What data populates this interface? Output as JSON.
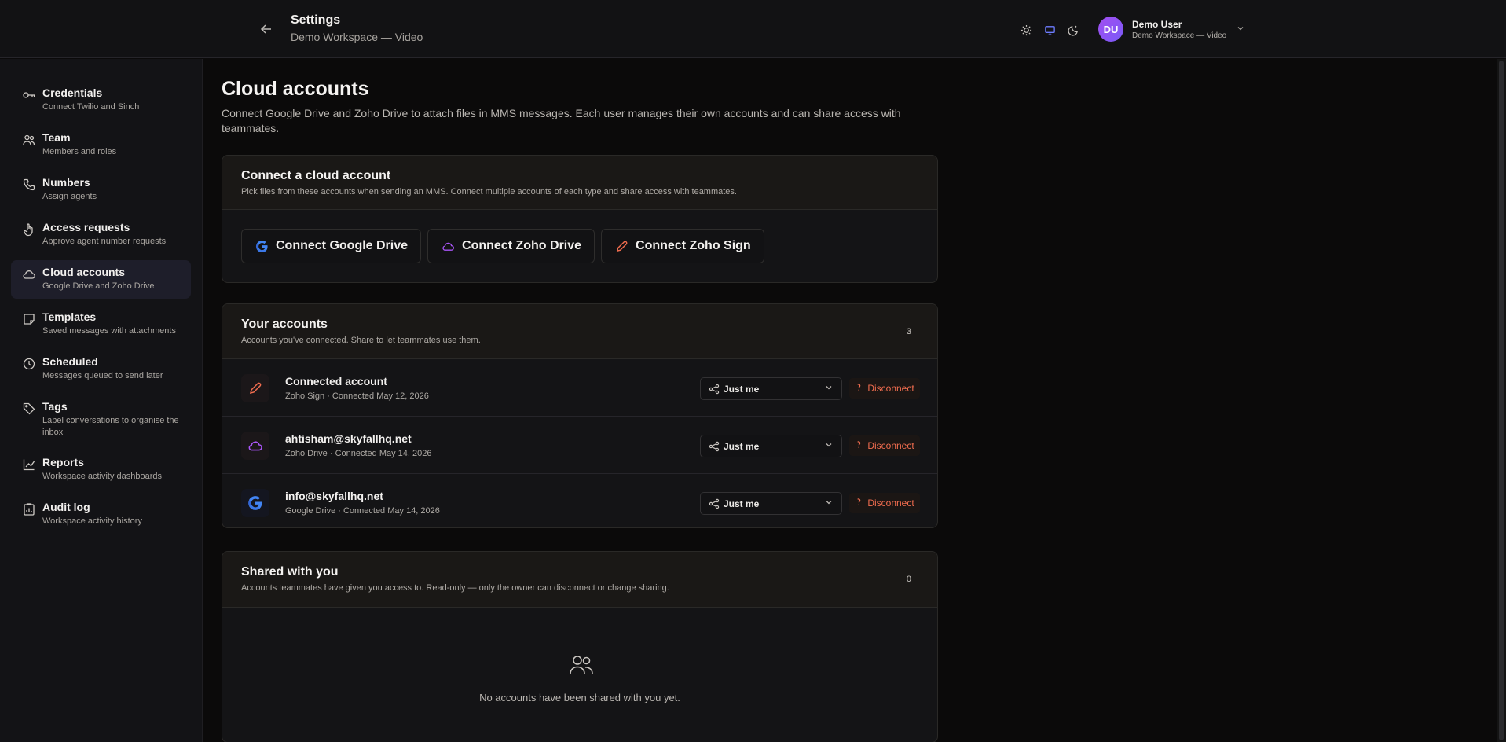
{
  "header": {
    "title": "Settings",
    "subtitle": "Demo Workspace — Video",
    "user": {
      "initials": "DU",
      "name": "Demo User",
      "workspace": "Demo Workspace — Video"
    }
  },
  "sidebar": {
    "items": [
      {
        "label": "Credentials",
        "desc": "Connect Twilio and Sinch",
        "icon": "key-icon"
      },
      {
        "label": "Team",
        "desc": "Members and roles",
        "icon": "users-icon"
      },
      {
        "label": "Numbers",
        "desc": "Assign agents",
        "icon": "phone-icon"
      },
      {
        "label": "Access requests",
        "desc": "Approve agent number requests",
        "icon": "hand-pointer-icon"
      },
      {
        "label": "Cloud accounts",
        "desc": "Google Drive and Zoho Drive",
        "icon": "cloud-icon"
      },
      {
        "label": "Templates",
        "desc": "Saved messages with attachments",
        "icon": "sticky-note-icon"
      },
      {
        "label": "Scheduled",
        "desc": "Messages queued to send later",
        "icon": "clock-icon"
      },
      {
        "label": "Tags",
        "desc": "Label conversations to organise the inbox",
        "icon": "tag-icon"
      },
      {
        "label": "Reports",
        "desc": "Workspace activity dashboards",
        "icon": "line-chart-icon"
      },
      {
        "label": "Audit log",
        "desc": "Workspace activity history",
        "icon": "clipboard-chart-icon"
      }
    ]
  },
  "main": {
    "title": "Cloud accounts",
    "description": "Connect Google Drive and Zoho Drive to attach files in MMS messages. Each user manages their own accounts and can share access with teammates.",
    "connect_card": {
      "title": "Connect a cloud account",
      "desc": "Pick files from these accounts when sending an MMS. Connect multiple accounts of each type and share access with teammates.",
      "buttons": [
        "Connect Google Drive",
        "Connect Zoho Drive",
        "Connect Zoho Sign"
      ]
    },
    "your_accounts": {
      "title": "Your accounts",
      "desc": "Accounts you've connected. Share to let teammates use them.",
      "count": "3",
      "rows": [
        {
          "name": "Connected account",
          "meta": "Zoho Sign · Connected May 12, 2026",
          "share": "Just me",
          "action": "Disconnect"
        },
        {
          "name": "ahtisham@skyfallhq.net",
          "meta": "Zoho Drive · Connected May 14, 2026",
          "share": "Just me",
          "action": "Disconnect"
        },
        {
          "name": "info@skyfallhq.net",
          "meta": "Google Drive · Connected May 14, 2026",
          "share": "Just me",
          "action": "Disconnect"
        }
      ]
    },
    "shared": {
      "title": "Shared with you",
      "desc": "Accounts teammates have given you access to. Read-only — only the owner can disconnect or change sharing.",
      "count": "0",
      "empty": "No accounts have been shared with you yet."
    }
  },
  "colors": {
    "accent_orange": "#f26d4f",
    "zoho_drive_purple": "#a855f7",
    "google_blue": "#4285f4",
    "avatar_gradient": "#a24ef0"
  }
}
